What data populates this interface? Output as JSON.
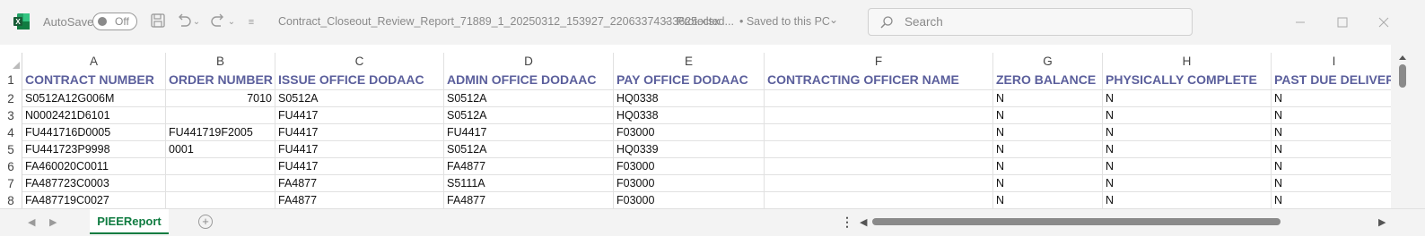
{
  "titlebar": {
    "autosave_label": "AutoSave",
    "autosave_state": "Off",
    "file_name": "Contract_Closeout_Review_Report_71889_1_20250312_153927_22063374333625.xlsx",
    "separator1": "-",
    "protected_label": "Protected...",
    "saved_label": "• Saved to this PC",
    "search_placeholder": "Search",
    "brand_color": "#107c41"
  },
  "grid": {
    "columns": [
      "A",
      "B",
      "C",
      "D",
      "E",
      "F",
      "G",
      "H",
      "I"
    ],
    "rows": [
      "1",
      "2",
      "3",
      "4",
      "5",
      "6",
      "7",
      "8"
    ],
    "header": [
      "CONTRACT NUMBER",
      "ORDER NUMBER",
      "ISSUE OFFICE DODAAC",
      "ADMIN OFFICE DODAAC",
      "PAY OFFICE DODAAC",
      "CONTRACTING OFFICER NAME",
      "ZERO BALANCE",
      "PHYSICALLY COMPLETE",
      "PAST DUE DELIVER"
    ],
    "data": [
      [
        "S0512A12G006M",
        "7010",
        "S0512A",
        "S0512A",
        "HQ0338",
        "",
        "N",
        "N",
        "N"
      ],
      [
        "N0002421D6101",
        "",
        "FU4417",
        "S0512A",
        "HQ0338",
        "",
        "N",
        "N",
        "N"
      ],
      [
        "FU441716D0005",
        "FU441719F2005",
        "FU4417",
        "FU4417",
        "F03000",
        "",
        "N",
        "N",
        "N"
      ],
      [
        "FU441723P9998",
        "0001",
        "FU4417",
        "S0512A",
        "HQ0339",
        "",
        "N",
        "N",
        "N"
      ],
      [
        "FA460020C0011",
        "",
        "FU4417",
        "FA4877",
        "F03000",
        "",
        "N",
        "N",
        "N"
      ],
      [
        "FA487723C0003",
        "",
        "FA4877",
        "S5111A",
        "F03000",
        "",
        "N",
        "N",
        "N"
      ],
      [
        "FA487719C0027",
        "",
        "FA4877",
        "FA4877",
        "F03000",
        "",
        "N",
        "N",
        "N"
      ]
    ],
    "header_color": "#5b5f9c"
  },
  "sheets": {
    "tabs": [
      "PIEEReport"
    ],
    "active_color": "#107c41"
  }
}
